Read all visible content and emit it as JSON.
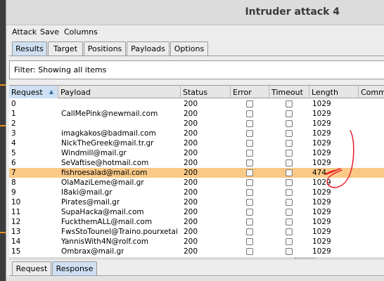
{
  "window": {
    "title": "Intruder attack 4"
  },
  "menu": [
    "Attack",
    "Save",
    "Columns"
  ],
  "tabs": [
    "Results",
    "Target",
    "Positions",
    "Payloads",
    "Options"
  ],
  "filter": {
    "text": "Filter: Showing all items"
  },
  "table": {
    "columns": [
      "Request",
      "Payload",
      "Status",
      "Error",
      "Timeout",
      "Length",
      "Comme"
    ],
    "sorted_column": "Request",
    "selected_request": "7",
    "rows": [
      {
        "request": "0",
        "payload": "",
        "status": "200",
        "length": "1029"
      },
      {
        "request": "1",
        "payload": "CallMePink@newmail.com",
        "status": "200",
        "length": "1029"
      },
      {
        "request": "2",
        "payload": "",
        "status": "200",
        "length": "1029"
      },
      {
        "request": "3",
        "payload": "imagkakos@badmail.com",
        "status": "200",
        "length": "1029"
      },
      {
        "request": "4",
        "payload": "NickTheGreek@mail.tr.gr",
        "status": "200",
        "length": "1029"
      },
      {
        "request": "5",
        "payload": "Windmill@mail.gr",
        "status": "200",
        "length": "1029"
      },
      {
        "request": "6",
        "payload": "SeVaftise@hotmail.com",
        "status": "200",
        "length": "1029"
      },
      {
        "request": "7",
        "payload": "fishroesalad@mail.com",
        "status": "200",
        "length": "474"
      },
      {
        "request": "8",
        "payload": "OlaMaziLeme@mail.gr",
        "status": "200",
        "length": "1029"
      },
      {
        "request": "9",
        "payload": "I8aki@mail.gr",
        "status": "200",
        "length": "1029"
      },
      {
        "request": "10",
        "payload": "Pirates@mail.gr",
        "status": "200",
        "length": "1029"
      },
      {
        "request": "11",
        "payload": "SupaHacka@mail.com",
        "status": "200",
        "length": "1029"
      },
      {
        "request": "12",
        "payload": "FuckthemALL@mail.com",
        "status": "200",
        "length": "1029"
      },
      {
        "request": "13",
        "payload": "FwsStoTounel@Traino.pourxetai",
        "status": "200",
        "length": "1029"
      },
      {
        "request": "14",
        "payload": "YannisWith4N@rolf.com",
        "status": "200",
        "length": "1029"
      },
      {
        "request": "15",
        "payload": "Ombrax@mail.gr",
        "status": "200",
        "length": "1029"
      }
    ]
  },
  "bottom_tabs": [
    "Request",
    "Response"
  ],
  "active_bottom_tab": "Response",
  "annotation": {
    "color": "#e8202a"
  },
  "colors": {
    "selected_row": "#fbc987",
    "active_tab": "#cfe0f3"
  }
}
